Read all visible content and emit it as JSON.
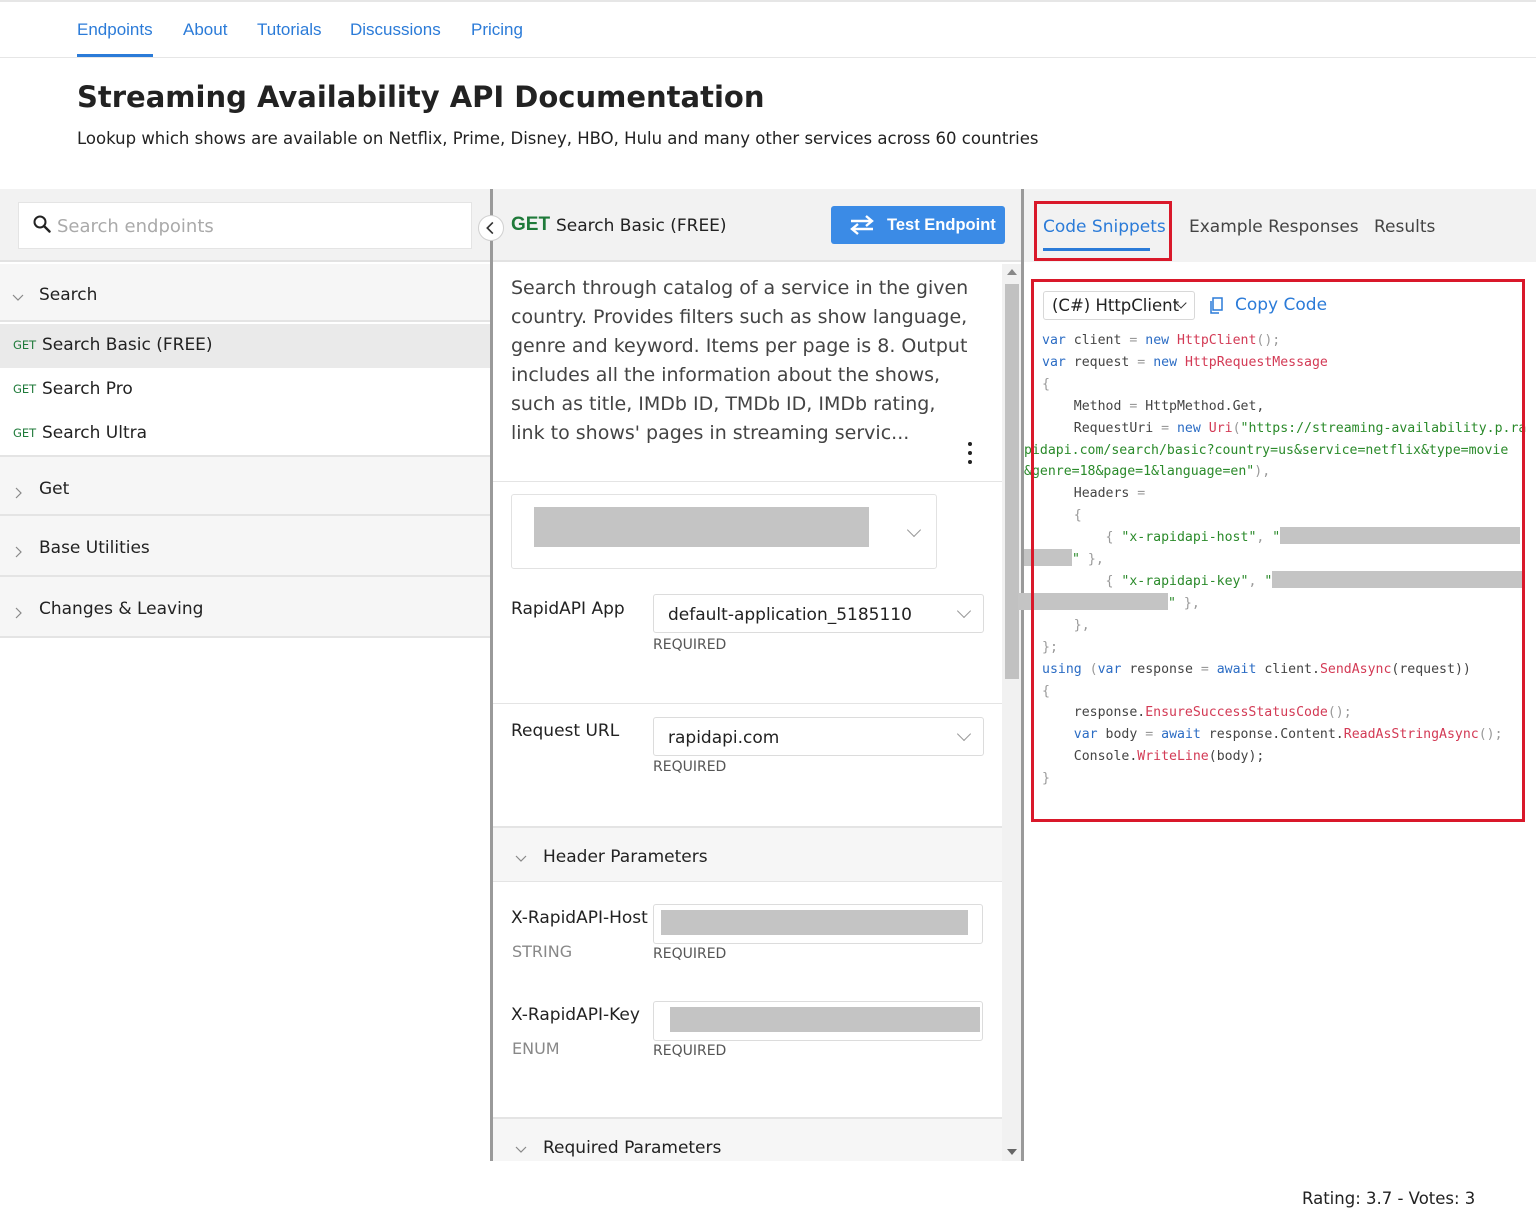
{
  "nav": {
    "tabs": [
      "Endpoints",
      "About",
      "Tutorials",
      "Discussions",
      "Pricing"
    ],
    "active": "Endpoints"
  },
  "page": {
    "title": "Streaming Availability API Documentation",
    "subtitle": "Lookup which shows are available on Netflix, Prime, Disney, HBO, Hulu and many other services across 60 countries"
  },
  "sidebar": {
    "search_placeholder": "Search endpoints",
    "groups": {
      "search": "Search",
      "get": "Get",
      "base": "Base Utilities",
      "changes": "Changes & Leaving"
    },
    "endpoints": [
      {
        "method": "GET",
        "name": "Search Basic (FREE)"
      },
      {
        "method": "GET",
        "name": "Search Pro"
      },
      {
        "method": "GET",
        "name": "Search Ultra"
      }
    ]
  },
  "endpoint": {
    "method": "GET",
    "name": "Search Basic (FREE)",
    "test_button": "Test Endpoint",
    "description": "Search through catalog of a service in the given country. Provides filters such as show language, genre and keyword. Items per page is 8. Output includes all the information about the shows, such as title, IMDb ID, TMDb ID, IMDb rating, link to shows' pages in streaming servic...",
    "rapidapi_app_label": "RapidAPI App",
    "rapidapi_app_value": "default-application_5185110",
    "request_url_label": "Request URL",
    "request_url_value": "rapidapi.com",
    "required": "REQUIRED",
    "header_params_title": "Header Parameters",
    "host_label": "X-RapidAPI-Host",
    "host_type": "STRING",
    "key_label": "X-RapidAPI-Key",
    "key_type": "ENUM",
    "required_params_title": "Required Parameters"
  },
  "right": {
    "tabs": [
      "Code Snippets",
      "Example Responses",
      "Results"
    ],
    "active": "Code Snippets",
    "language": "(C#) HttpClient",
    "copy_label": "Copy Code"
  },
  "code": {
    "l1": [
      "var",
      " client ",
      "=",
      " new ",
      "HttpClient",
      "();"
    ],
    "l2": [
      "var",
      " request ",
      "=",
      " new ",
      "HttpRequestMessage"
    ],
    "l3": "{",
    "l4": [
      "    Method ",
      "=",
      " HttpMethod.Get,"
    ],
    "l5": [
      "    RequestUri ",
      "=",
      " new ",
      "Uri",
      "(",
      "\"https://streaming-availability.p.ra"
    ],
    "l6": "pidapi.com/search/basic?country=us&service=netflix&type=movie",
    "l7": [
      "&genre=18&page=1&language=en\"",
      "),"
    ],
    "l8": [
      "    Headers ",
      "="
    ],
    "l9": "    {",
    "l10": [
      "        { ",
      "\"x-rapidapi-host\"",
      ", ",
      "\""
    ],
    "l11": [
      "\"",
      " },"
    ],
    "l12": [
      "        { ",
      "\"x-rapidapi-key\"",
      ", ",
      "\""
    ],
    "l13": [
      "\"",
      " },"
    ],
    "l14": "    },",
    "l15": "};",
    "l16": [
      "using",
      " (",
      "var",
      " response ",
      "=",
      " await",
      " client.",
      "SendAsync",
      "(request))"
    ],
    "l17": "{",
    "l18": [
      "    response.",
      "EnsureSuccessStatusCode",
      "();"
    ],
    "l19": [
      "    ",
      "var",
      " body ",
      "=",
      " await",
      " response.Content.",
      "ReadAsStringAsync",
      "();"
    ],
    "l20": [
      "    Console.",
      "WriteLine",
      "(body);"
    ],
    "l21": "}"
  },
  "footer": {
    "rating": "Rating: 3.7 - Votes: 3"
  },
  "colors": {
    "accent": "#2b7bd8",
    "button": "#3b8be6",
    "get_method": "#1f7a3a",
    "highlight": "#d9182a",
    "code_keyword": "#2b6cc4",
    "code_type": "#d33a55",
    "code_string": "#2a8a2a"
  }
}
